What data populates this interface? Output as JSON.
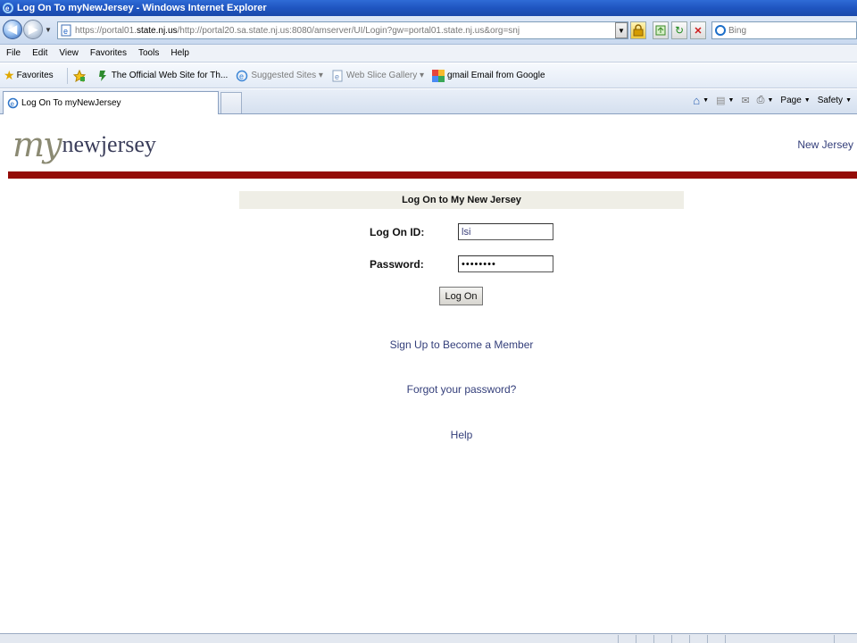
{
  "window": {
    "title": "Log On To myNewJersey - Windows Internet Explorer"
  },
  "address": {
    "url_prefix": "https://portal01.",
    "url_host": "state.nj.us",
    "url_rest": "/http://portal20.sa.state.nj.us:8080/amserver/UI/Login?gw=portal01.state.nj.us&org=snj",
    "search_placeholder": "Bing"
  },
  "menu": [
    "File",
    "Edit",
    "View",
    "Favorites",
    "Tools",
    "Help"
  ],
  "favorites": {
    "label": "Favorites",
    "items": [
      {
        "label": "The Official Web Site for Th...",
        "dim": false
      },
      {
        "label": "Suggested Sites ▾",
        "dim": true
      },
      {
        "label": "Web Slice Gallery ▾",
        "dim": true
      },
      {
        "label": "gmail Email from Google",
        "dim": false
      }
    ]
  },
  "tab": {
    "label": "Log On To myNewJersey"
  },
  "commands": {
    "page": "Page",
    "safety": "Safety"
  },
  "page": {
    "logo_my": "my",
    "logo_nj": "newjersey",
    "top_link": "New Jersey",
    "panel_title": "Log On to My New Jersey",
    "logon_id_label": "Log On ID:",
    "logon_id_value": "lsi",
    "password_label": "Password:",
    "password_value": "••••••••",
    "logon_button": "Log On",
    "signup_link": "Sign Up to Become a Member",
    "forgot_link": "Forgot your password?",
    "help_link": "Help"
  },
  "colors": {
    "red_bar": "#940c07",
    "link": "#333e7a",
    "titlebar": "#1f55c0"
  }
}
